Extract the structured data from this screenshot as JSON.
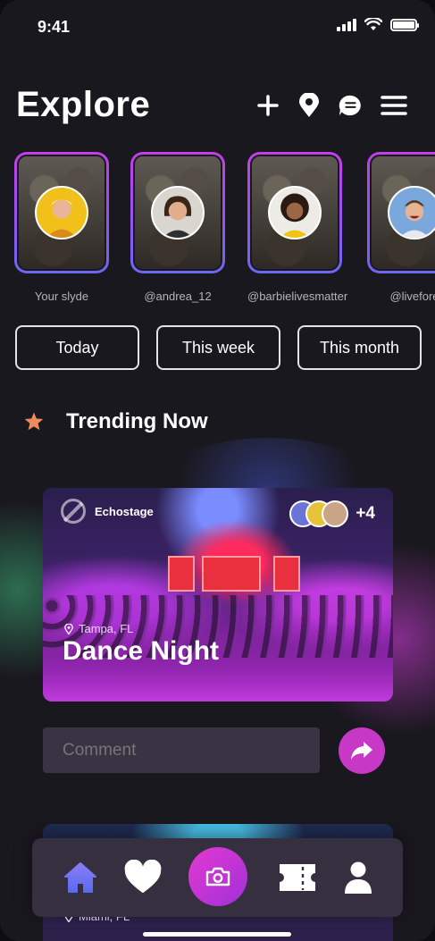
{
  "status_bar": {
    "time": "9:41"
  },
  "header": {
    "title": "Explore",
    "actions": [
      "plus-icon",
      "location-pin-icon",
      "chat-bubble-icon",
      "menu-icon"
    ]
  },
  "stories": [
    {
      "label": "Your slyde",
      "avatar_color": "#f2c01b"
    },
    {
      "label": "@andrea_12",
      "avatar_color": "#d9d6cf"
    },
    {
      "label": "@barbielivesmatter",
      "avatar_color": "#ecebe6"
    },
    {
      "label": "@livefore",
      "avatar_color": "#7aa8dd"
    }
  ],
  "filters": {
    "today": "Today",
    "this_week": "This week",
    "this_month": "This month"
  },
  "trending": {
    "title": "Trending Now",
    "icon": "star-icon"
  },
  "event": {
    "brand": "Echostage",
    "attendee_count": "+4",
    "location": "Tampa, FL",
    "title": "Dance Night"
  },
  "comment": {
    "placeholder": "Comment"
  },
  "event_2": {
    "location": "Miami, FL"
  },
  "nav": [
    "home-icon",
    "heart-icon",
    "camera-icon",
    "ticket-icon",
    "user-icon"
  ],
  "colors": {
    "accent": "#c738c6",
    "background": "#1a181f",
    "story_gradient_top": "#c53ee8",
    "story_gradient_bottom": "#6e66f2"
  }
}
